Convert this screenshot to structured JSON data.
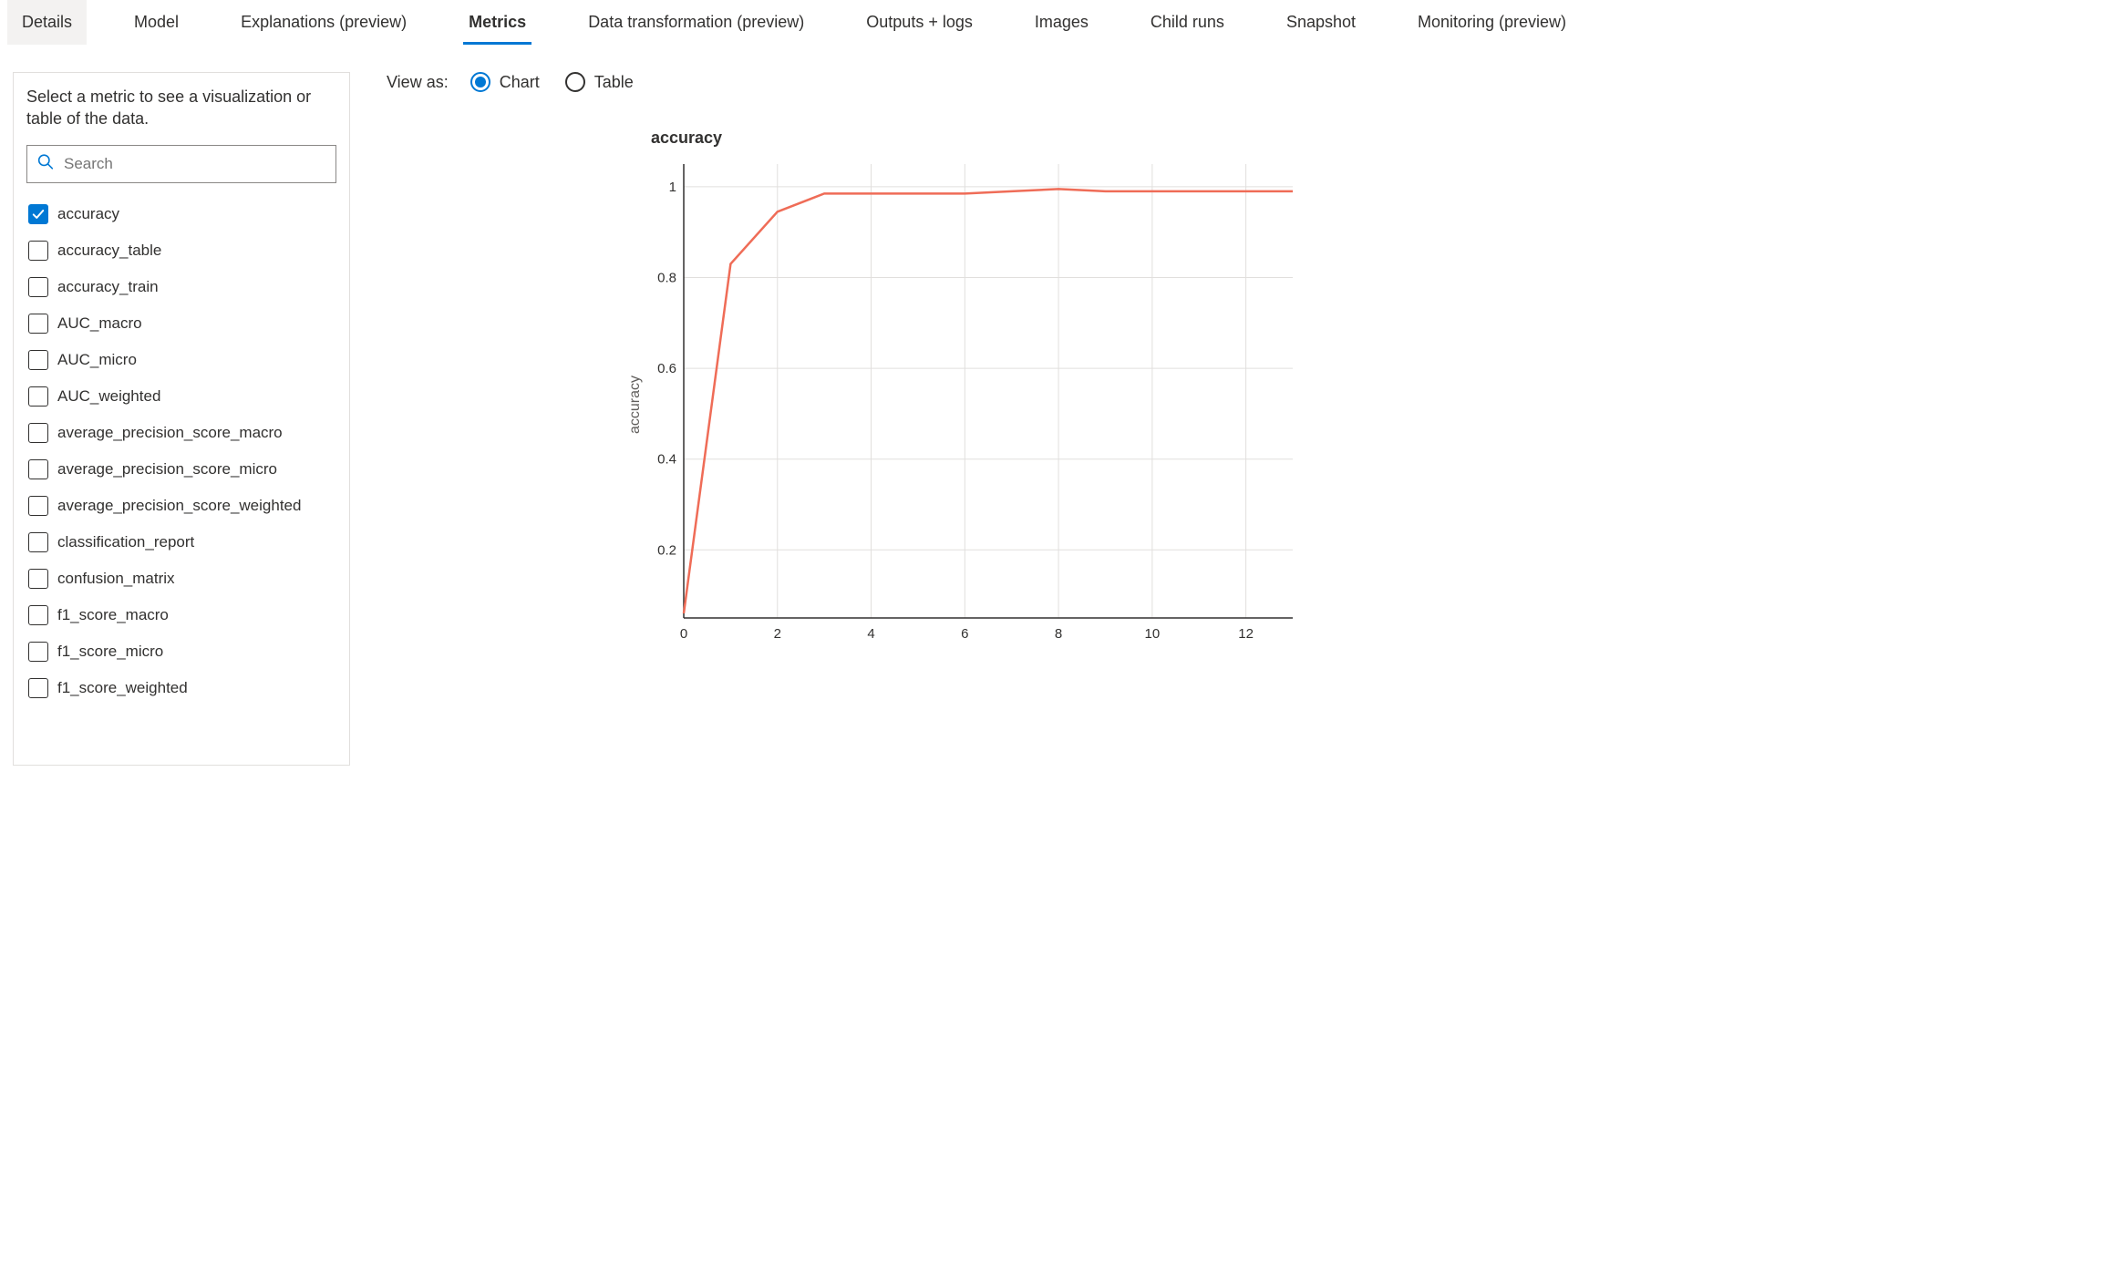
{
  "tabs": [
    {
      "label": "Details",
      "state": "bg"
    },
    {
      "label": "Model"
    },
    {
      "label": "Explanations (preview)"
    },
    {
      "label": "Metrics",
      "state": "active"
    },
    {
      "label": "Data transformation (preview)"
    },
    {
      "label": "Outputs + logs"
    },
    {
      "label": "Images"
    },
    {
      "label": "Child runs"
    },
    {
      "label": "Snapshot"
    },
    {
      "label": "Monitoring (preview)"
    }
  ],
  "sidebar": {
    "description": "Select a metric to see a visualization or table of the data.",
    "search_placeholder": "Search",
    "metrics": [
      {
        "label": "accuracy",
        "checked": true
      },
      {
        "label": "accuracy_table",
        "checked": false
      },
      {
        "label": "accuracy_train",
        "checked": false
      },
      {
        "label": "AUC_macro",
        "checked": false
      },
      {
        "label": "AUC_micro",
        "checked": false
      },
      {
        "label": "AUC_weighted",
        "checked": false
      },
      {
        "label": "average_precision_score_macro",
        "checked": false
      },
      {
        "label": "average_precision_score_micro",
        "checked": false
      },
      {
        "label": "average_precision_score_weighted",
        "checked": false
      },
      {
        "label": "classification_report",
        "checked": false
      },
      {
        "label": "confusion_matrix",
        "checked": false
      },
      {
        "label": "f1_score_macro",
        "checked": false
      },
      {
        "label": "f1_score_micro",
        "checked": false
      },
      {
        "label": "f1_score_weighted",
        "checked": false
      }
    ]
  },
  "viewas": {
    "label": "View as:",
    "options": [
      {
        "label": "Chart",
        "selected": true
      },
      {
        "label": "Table",
        "selected": false
      }
    ]
  },
  "chart_data": {
    "type": "line",
    "title": "accuracy",
    "xlabel": "",
    "ylabel": "accuracy",
    "x_ticks": [
      0,
      2,
      4,
      6,
      8,
      10,
      12
    ],
    "y_ticks": [
      0.2,
      0.4,
      0.6,
      0.8,
      1
    ],
    "xlim": [
      0,
      13
    ],
    "ylim": [
      0.05,
      1.05
    ],
    "x": [
      0,
      1,
      2,
      3,
      4,
      5,
      6,
      7,
      8,
      9,
      10,
      11,
      12,
      13
    ],
    "values": [
      0.06,
      0.83,
      0.945,
      0.985,
      0.985,
      0.985,
      0.985,
      0.99,
      0.995,
      0.99,
      0.99,
      0.99,
      0.99,
      0.99
    ],
    "series_color": "#ef6c57"
  }
}
